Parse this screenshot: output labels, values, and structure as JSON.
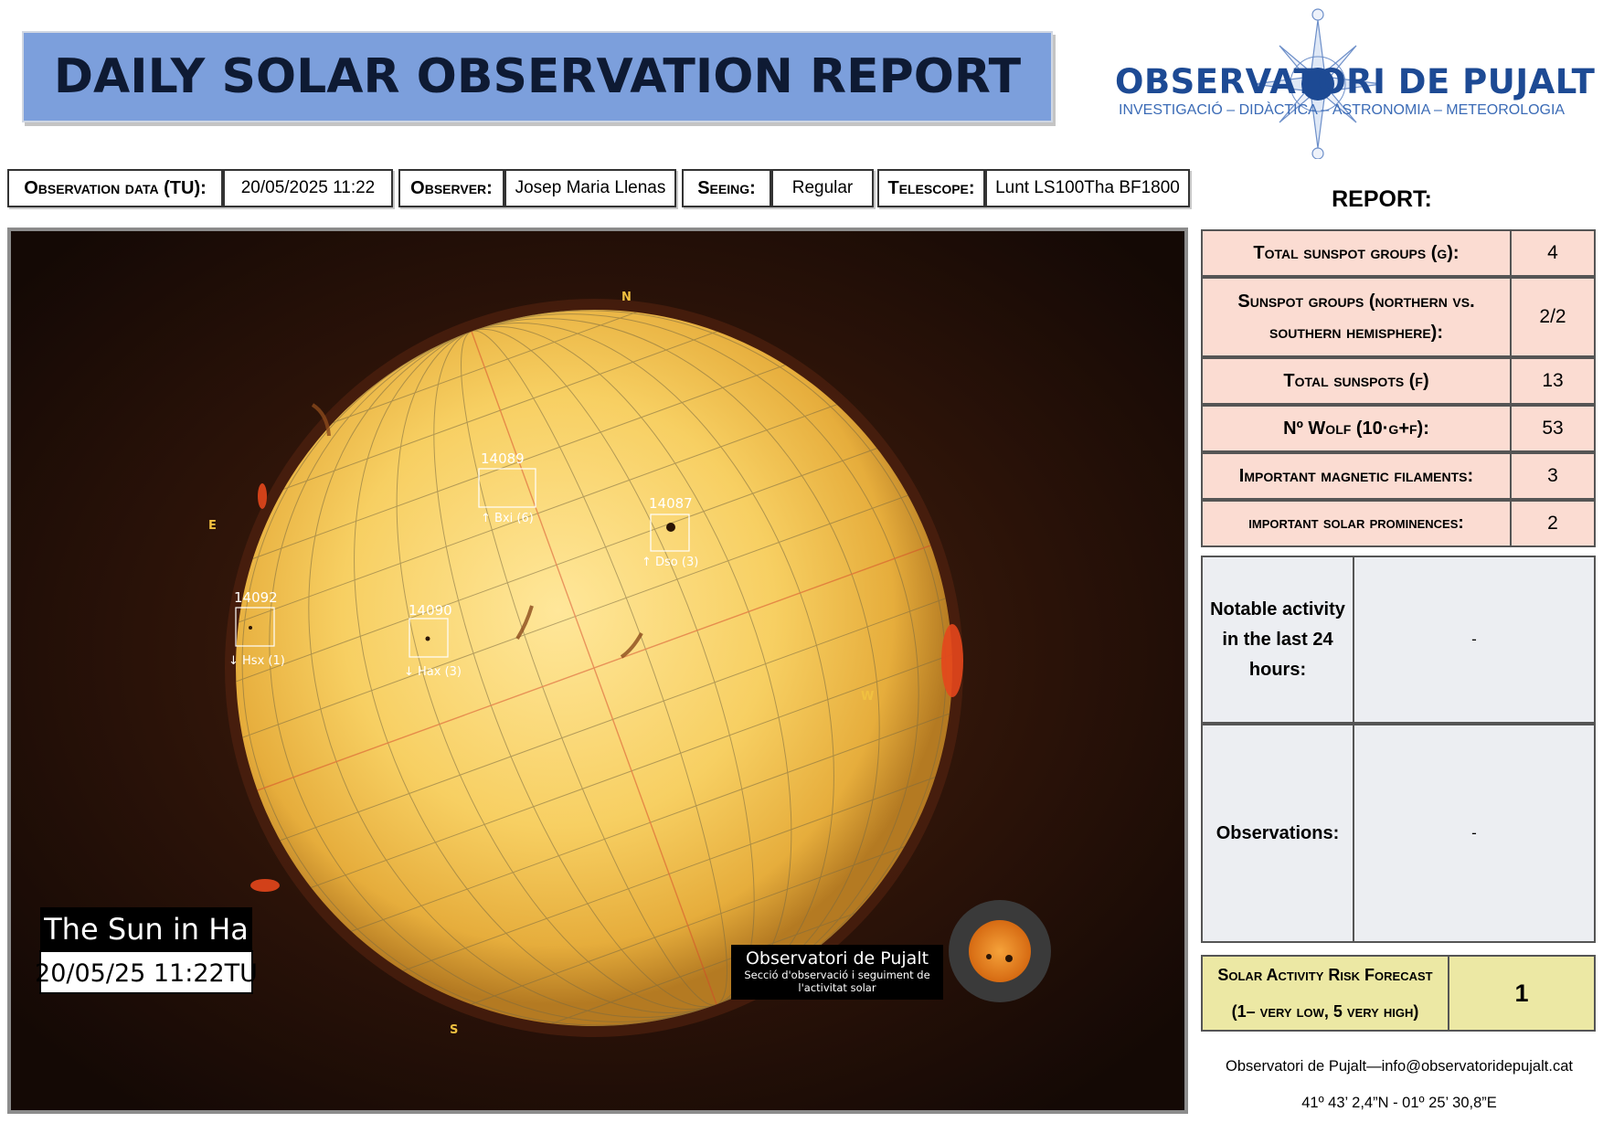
{
  "title": "DAILY SOLAR OBSERVATION REPORT",
  "logo": {
    "name": "OBSERVATORI DE PUJALT",
    "tagline": "INVESTIGACIÓ – DIDÀCTICA – ASTRONOMIA – METEOROLOGIA"
  },
  "info": {
    "date_label": "Observation data (TU):",
    "date_value": "20/05/2025 11:22",
    "observer_label": "Observer:",
    "observer_value": "Josep Maria Llenas",
    "seeing_label": "Seeing:",
    "seeing_value": "Regular",
    "telescope_label": "Telescope:",
    "telescope_value": "Lunt LS100Tha BF1800"
  },
  "sun_image": {
    "caption_title": "The Sun in Ha",
    "caption_date": "20/05/25 11:22TU",
    "watermark_title": "Observatori de Pujalt",
    "watermark_sub1": "Secció d'observació i seguiment de",
    "watermark_sub2": "l'activitat solar",
    "directions": {
      "n": "N",
      "s": "S",
      "e": "E",
      "w": "W"
    },
    "regions": [
      {
        "number": "14089",
        "class": "↑ Bxi (6)"
      },
      {
        "number": "14087",
        "class": "↑ Dso (3)"
      },
      {
        "number": "14092",
        "class": "↓ Hsx (1)"
      },
      {
        "number": "14090",
        "class": "↓ Hax (3)"
      }
    ]
  },
  "report": {
    "heading": "REPORT:",
    "rows": [
      {
        "label": "Total sunspot groups (g):",
        "value": "4"
      },
      {
        "label": "Sunspot groups (northern vs. southern hemisphere):",
        "value": "2/2"
      },
      {
        "label": "Total sunspots (f)",
        "value": "13"
      },
      {
        "label": "Nº Wolf (10·g+f):",
        "value": "53"
      },
      {
        "label": "Important magnetic filaments:",
        "value": "3"
      },
      {
        "label": "important solar prominences:",
        "value": "2"
      }
    ],
    "notable_label": "Notable activity in the last 24 hours:",
    "notable_value": "-",
    "observations_label": "Observations:",
    "observations_value": "-",
    "risk_label_line1": "Solar Activity Risk Forecast",
    "risk_label_line2": "(1– very low, 5 very high)",
    "risk_value": "1"
  },
  "footer": {
    "contact": "Observatori de Pujalt—info@observatoridepujalt.cat",
    "coords": "41º 43’ 2,4”N - 01º 25’ 30,8”E"
  },
  "colors": {
    "banner": "#7c9fdc",
    "report_pink": "#fbdcd2",
    "report_grey": "#eceef2",
    "risk_yellow": "#ece8a4",
    "logo_blue": "#1d4a94"
  }
}
